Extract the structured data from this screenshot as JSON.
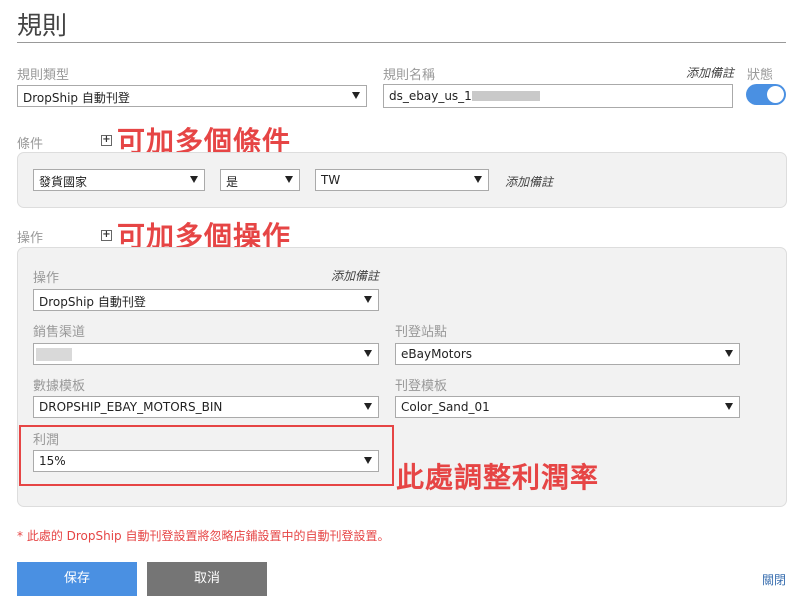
{
  "page_title": "規則",
  "rule_type": {
    "label": "規則類型",
    "value": "DropShip 自動刊登"
  },
  "rule_name": {
    "label": "規則名稱",
    "value": "ds_ebay_us_1",
    "note": "添加備註"
  },
  "status_label": "狀態",
  "conditions": {
    "label": "條件",
    "annotation": "可加多個條件",
    "row": {
      "field": "發貨國家",
      "operator": "是",
      "value": "TW",
      "note": "添加備註"
    }
  },
  "operations": {
    "label": "操作",
    "annotation": "可加多個操作",
    "op_label": "操作",
    "op_note": "添加備註",
    "op_value": "DropShip 自動刊登",
    "channel_label": "銷售渠道",
    "site_label": "刊登站點",
    "site_value": "eBayMotors",
    "data_template_label": "數據模板",
    "data_template_value": "DROPSHIP_EBAY_MOTORS_BIN",
    "listing_template_label": "刊登模板",
    "listing_template_value": "Color_Sand_01",
    "profit_label": "利潤",
    "profit_value": "15%",
    "profit_annotation": "此處調整利潤率"
  },
  "footer_note": "* 此處的 DropShip 自動刊登設置將忽略店鋪設置中的自動刊登設置。",
  "buttons": {
    "save": "保存",
    "cancel": "取消",
    "close": "關閉"
  },
  "colors": {
    "accent": "#4a90e2",
    "annotation": "#e64545",
    "cancel": "#757575"
  }
}
